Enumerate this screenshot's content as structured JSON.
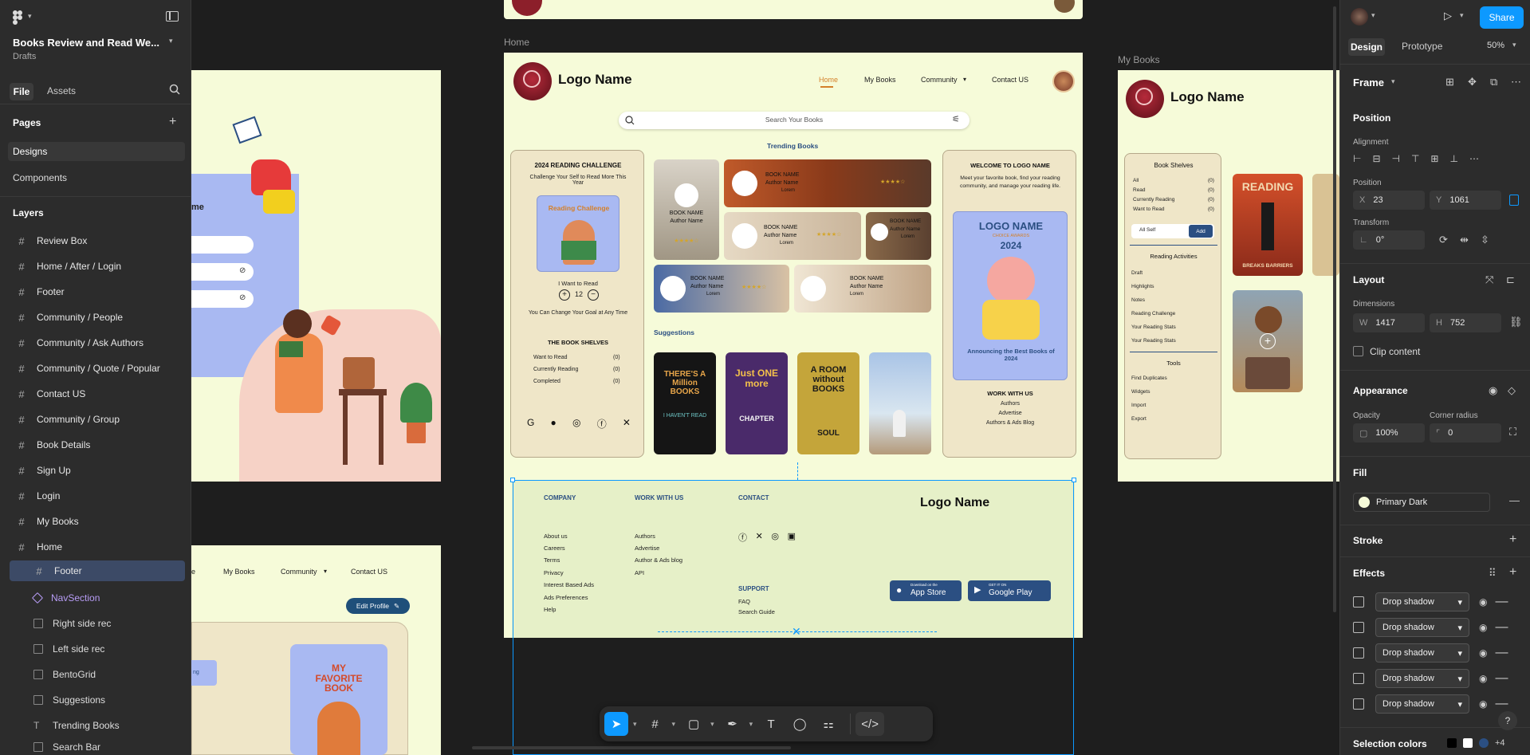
{
  "file": {
    "name": "Books Review and Read We...",
    "location": "Drafts"
  },
  "left_tabs": {
    "file": "File",
    "assets": "Assets"
  },
  "pages": {
    "title": "Pages",
    "items": [
      "Designs",
      "Components"
    ]
  },
  "layers": {
    "title": "Layers",
    "items": [
      "Review Box",
      "Home / After / Login",
      "Footer",
      "Community / People",
      "Community / Ask Authors",
      "Community / Quote / Popular",
      "Contact US",
      "Community / Group",
      "Book Details",
      "Sign Up",
      "Login",
      "My Books",
      "Home"
    ],
    "children": [
      "Footer",
      "NavSection",
      "Right side rec",
      "Left side rec",
      "BentoGrid",
      "Suggestions",
      "Trending Books",
      "Search Bar"
    ]
  },
  "canvas": {
    "home_label": "Home",
    "mybooks_label": "My Books",
    "logo": "Logo Name",
    "nav": {
      "home": "Home",
      "mybooks": "My Books",
      "community": "Community",
      "contact": "Contact US"
    },
    "search_placeholder": "Search Your Books",
    "trending": "Trending Books",
    "challenge": {
      "title": "2024 READING CHALLENGE",
      "sub": "Challenge Your Self to Read More This Year",
      "card": "Reading Challenge",
      "want": "I Want to Read",
      "count": "12",
      "change": "You Can Change Your Goal at Any Time"
    },
    "shelves": {
      "title": "THE BOOK SHELVES",
      "rows": [
        {
          "k": "Want to Read",
          "v": "(0)"
        },
        {
          "k": "Currently Reading",
          "v": "(0)"
        },
        {
          "k": "Completed",
          "v": "(0)"
        }
      ]
    },
    "book": {
      "name": "BOOK NAME",
      "author": "Author Name",
      "lorem": "Lorem"
    },
    "suggestions": "Suggestions",
    "covers": [
      {
        "a": "THERE'S A Million BOOKS",
        "b": "I HAVEN'T READ"
      },
      {
        "a": "Just ONE more",
        "b": "CHAPTER"
      },
      {
        "a": "A ROOM without BOOKS",
        "b": "SOUL"
      }
    ],
    "welcome": {
      "title": "WELCOME TO LOGO NAME",
      "sub": "Meet your favorite book, find your reading community, and manage your reading life.",
      "card_title": "LOGO NAME",
      "card_small": "CHOICE AWARDS",
      "card_year": "2024",
      "card_caption": "Announcing the Best Books of 2024",
      "work": "WORK WITH US",
      "links": [
        "Authors",
        "Advertise",
        "Authors & Ads Blog"
      ]
    },
    "footer": {
      "company": "COMPANY",
      "company_links": [
        "About us",
        "Careers",
        "Terms",
        "Privacy",
        "Interest Based Ads",
        "Ads Preferences",
        "Help"
      ],
      "work": "WORK WITH US",
      "work_links": [
        "Authors",
        "Advertise",
        "Author & Ads blog",
        "API"
      ],
      "contact": "CONTACT",
      "support": "SUPPORT",
      "support_links": [
        "FAQ",
        "Search Guide"
      ],
      "logo": "Logo Name",
      "appstore_small": "Download on the",
      "appstore": "App Store",
      "gplay_small": "GET IT ON",
      "gplay": "Google Play"
    },
    "mybooks": {
      "shelves": "Book Shelves",
      "rows": [
        {
          "k": "All",
          "v": "(0)"
        },
        {
          "k": "Read",
          "v": "(0)"
        },
        {
          "k": "Currently Reading",
          "v": "(0)"
        },
        {
          "k": "Want to Read",
          "v": "(0)"
        }
      ],
      "all_self": "All Self",
      "add": "Add",
      "activities": "Reading Activities",
      "act_items": [
        "Draft",
        "Highlights",
        "Notes",
        "Reading Challenge",
        "Your Reading Stats",
        "Your Reading Stats"
      ],
      "tools": "Tools",
      "tool_items": [
        "Find Duplicates",
        "Widgets",
        "Import",
        "Export"
      ],
      "cover1": "READING",
      "cover1b": "BREAKS BARRIERS"
    },
    "profile": {
      "nav": [
        "e",
        "My Books",
        "Community",
        "Contact US"
      ],
      "edit": "Edit Profile",
      "fav": "MY FAVORITE BOOK",
      "frag": "ng"
    },
    "login_frag": "me"
  },
  "right": {
    "tabs": {
      "design": "Design",
      "prototype": "Prototype",
      "zoom": "50%"
    },
    "share": "Share",
    "frame": "Frame",
    "position": "Position",
    "alignment": "Alignment",
    "position_sub": "Position",
    "x": "23",
    "y": "1061",
    "transform": "Transform",
    "rotation": "0°",
    "layout": "Layout",
    "dimensions": "Dimensions",
    "w": "1417",
    "h": "752",
    "clip": "Clip content",
    "appearance": "Appearance",
    "opacity_label": "Opacity",
    "opacity": "100%",
    "corner_label": "Corner radius",
    "corner": "0",
    "fill": "Fill",
    "fill_value": "Primary Dark",
    "stroke": "Stroke",
    "effects": "Effects",
    "effect_items": [
      "Drop shadow",
      "Drop shadow",
      "Drop shadow",
      "Drop shadow",
      "Drop shadow"
    ],
    "selection_colors": "Selection colors",
    "sel_more": "+4"
  },
  "colors": {
    "accent": "#0d99ff",
    "layer_selected": "#3c4a66",
    "frame_bg": "#f6fbd9",
    "brand": "#2b4f82"
  }
}
